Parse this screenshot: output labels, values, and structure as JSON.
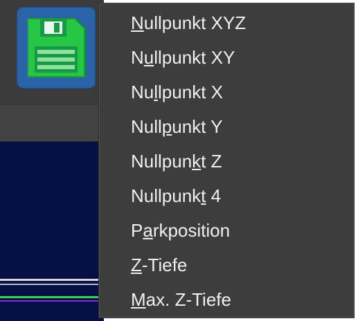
{
  "toolbar": {
    "save_icon": "floppy-disk-save-icon"
  },
  "menu": {
    "items": [
      {
        "id": "nullpunkt-xyz",
        "pre": "",
        "mn": "N",
        "post": "ullpunkt XYZ"
      },
      {
        "id": "nullpunkt-xy",
        "pre": "N",
        "mn": "u",
        "post": "llpunkt XY"
      },
      {
        "id": "nullpunkt-x",
        "pre": "Nu",
        "mn": "l",
        "post": "lpunkt X"
      },
      {
        "id": "nullpunkt-y",
        "pre": "Null",
        "mn": "p",
        "post": "unkt Y"
      },
      {
        "id": "nullpunkt-z",
        "pre": "Nullpun",
        "mn": "k",
        "post": "t Z"
      },
      {
        "id": "nullpunkt-4",
        "pre": "Nullpunk",
        "mn": "t",
        "post": " 4"
      },
      {
        "id": "parkposition",
        "pre": "P",
        "mn": "a",
        "post": "rkposition"
      },
      {
        "id": "z-tiefe",
        "pre": "",
        "mn": "Z",
        "post": "-Tiefe"
      },
      {
        "id": "max-z-tiefe",
        "pre": "",
        "mn": "M",
        "post": "ax. Z-Tiefe"
      }
    ]
  },
  "colors": {
    "menu_bg": "#3d3d3d",
    "menu_text": "#f0f0f0",
    "save_button_bg": "#2a64a8",
    "save_icon_green": "#28c447",
    "plot_bg": "#061045"
  }
}
